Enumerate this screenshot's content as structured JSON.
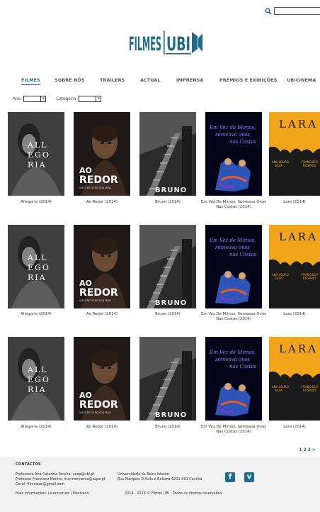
{
  "search": {
    "placeholder": ""
  },
  "logo": {
    "text_left": "FILMES",
    "text_right": "UBI"
  },
  "nav": {
    "items": [
      {
        "label": "FILMES",
        "active": true
      },
      {
        "label": "SOBRE NÓS"
      },
      {
        "label": "TRAILERS"
      },
      {
        "label": "ACTUAL"
      },
      {
        "label": "IMPRENSA"
      },
      {
        "label": "PRÉMIOS E EXIBIÇÕES"
      },
      {
        "label": "UBICINEMA"
      }
    ]
  },
  "filters": {
    "year_label": "Ano",
    "category_label": "Categoria"
  },
  "films": [
    {
      "title": "Allegoria (2014)",
      "poster_text": [
        "ALL",
        "EGO",
        "RIA"
      ]
    },
    {
      "title": "Ao Redor (2014)",
      "poster_text": [
        "AO",
        "REDOR",
        "UM FILME DE NELSON FARIA"
      ]
    },
    {
      "title": "Bruno (2014)",
      "poster_text": [
        "BRUNO"
      ]
    },
    {
      "title": "Em Vez De Mimos, Semeava Ovos Nas Costas (2014)",
      "poster_text": [
        "Em Vez de Mimos,",
        "semeava ovos",
        "nas Costas"
      ]
    },
    {
      "title": "Lara (2014)",
      "poster_text": [
        "LARA",
        "ANA LOURO",
        "FRANCISCO",
        "SILVA",
        "ROSÁRIO"
      ]
    }
  ],
  "pagination": {
    "pages": [
      "1",
      "2",
      "3"
    ],
    "next": ">"
  },
  "footer": {
    "contacts_title": "CONTACTOS",
    "line1": "Professora Ana Catarina Pereira: acap@ubi.pt",
    "line2": "Professor Francisco Merino: merinocinema@sapo.pt",
    "line3": "Geral: filmesubi@gmail.com",
    "more_info": "Mais informações: Licenciatura | Mestrado",
    "university": "Universidade da Beira Interior",
    "address": "Rua Marquês D'Ávila e Bolama 6201-001 Covilhã",
    "copyright": "2014 - 2015 © Filmes UBI - Todos os direitos reservados.",
    "facebook": "f",
    "vimeo": "v"
  },
  "colors": {
    "accent": "#1e6b8f",
    "lara_yellow": "#f1a51b",
    "footer_bg": "#f1f1f1"
  }
}
